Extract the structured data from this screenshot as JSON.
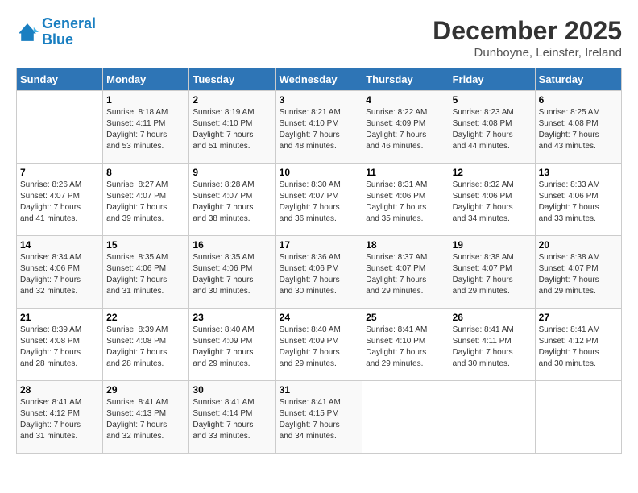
{
  "header": {
    "logo_line1": "General",
    "logo_line2": "Blue",
    "month": "December 2025",
    "location": "Dunboyne, Leinster, Ireland"
  },
  "days_of_week": [
    "Sunday",
    "Monday",
    "Tuesday",
    "Wednesday",
    "Thursday",
    "Friday",
    "Saturday"
  ],
  "weeks": [
    [
      {
        "day": "",
        "info": ""
      },
      {
        "day": "1",
        "info": "Sunrise: 8:18 AM\nSunset: 4:11 PM\nDaylight: 7 hours\nand 53 minutes."
      },
      {
        "day": "2",
        "info": "Sunrise: 8:19 AM\nSunset: 4:10 PM\nDaylight: 7 hours\nand 51 minutes."
      },
      {
        "day": "3",
        "info": "Sunrise: 8:21 AM\nSunset: 4:10 PM\nDaylight: 7 hours\nand 48 minutes."
      },
      {
        "day": "4",
        "info": "Sunrise: 8:22 AM\nSunset: 4:09 PM\nDaylight: 7 hours\nand 46 minutes."
      },
      {
        "day": "5",
        "info": "Sunrise: 8:23 AM\nSunset: 4:08 PM\nDaylight: 7 hours\nand 44 minutes."
      },
      {
        "day": "6",
        "info": "Sunrise: 8:25 AM\nSunset: 4:08 PM\nDaylight: 7 hours\nand 43 minutes."
      }
    ],
    [
      {
        "day": "7",
        "info": "Sunrise: 8:26 AM\nSunset: 4:07 PM\nDaylight: 7 hours\nand 41 minutes."
      },
      {
        "day": "8",
        "info": "Sunrise: 8:27 AM\nSunset: 4:07 PM\nDaylight: 7 hours\nand 39 minutes."
      },
      {
        "day": "9",
        "info": "Sunrise: 8:28 AM\nSunset: 4:07 PM\nDaylight: 7 hours\nand 38 minutes."
      },
      {
        "day": "10",
        "info": "Sunrise: 8:30 AM\nSunset: 4:07 PM\nDaylight: 7 hours\nand 36 minutes."
      },
      {
        "day": "11",
        "info": "Sunrise: 8:31 AM\nSunset: 4:06 PM\nDaylight: 7 hours\nand 35 minutes."
      },
      {
        "day": "12",
        "info": "Sunrise: 8:32 AM\nSunset: 4:06 PM\nDaylight: 7 hours\nand 34 minutes."
      },
      {
        "day": "13",
        "info": "Sunrise: 8:33 AM\nSunset: 4:06 PM\nDaylight: 7 hours\nand 33 minutes."
      }
    ],
    [
      {
        "day": "14",
        "info": "Sunrise: 8:34 AM\nSunset: 4:06 PM\nDaylight: 7 hours\nand 32 minutes."
      },
      {
        "day": "15",
        "info": "Sunrise: 8:35 AM\nSunset: 4:06 PM\nDaylight: 7 hours\nand 31 minutes."
      },
      {
        "day": "16",
        "info": "Sunrise: 8:35 AM\nSunset: 4:06 PM\nDaylight: 7 hours\nand 30 minutes."
      },
      {
        "day": "17",
        "info": "Sunrise: 8:36 AM\nSunset: 4:06 PM\nDaylight: 7 hours\nand 30 minutes."
      },
      {
        "day": "18",
        "info": "Sunrise: 8:37 AM\nSunset: 4:07 PM\nDaylight: 7 hours\nand 29 minutes."
      },
      {
        "day": "19",
        "info": "Sunrise: 8:38 AM\nSunset: 4:07 PM\nDaylight: 7 hours\nand 29 minutes."
      },
      {
        "day": "20",
        "info": "Sunrise: 8:38 AM\nSunset: 4:07 PM\nDaylight: 7 hours\nand 29 minutes."
      }
    ],
    [
      {
        "day": "21",
        "info": "Sunrise: 8:39 AM\nSunset: 4:08 PM\nDaylight: 7 hours\nand 28 minutes."
      },
      {
        "day": "22",
        "info": "Sunrise: 8:39 AM\nSunset: 4:08 PM\nDaylight: 7 hours\nand 28 minutes."
      },
      {
        "day": "23",
        "info": "Sunrise: 8:40 AM\nSunset: 4:09 PM\nDaylight: 7 hours\nand 29 minutes."
      },
      {
        "day": "24",
        "info": "Sunrise: 8:40 AM\nSunset: 4:09 PM\nDaylight: 7 hours\nand 29 minutes."
      },
      {
        "day": "25",
        "info": "Sunrise: 8:41 AM\nSunset: 4:10 PM\nDaylight: 7 hours\nand 29 minutes."
      },
      {
        "day": "26",
        "info": "Sunrise: 8:41 AM\nSunset: 4:11 PM\nDaylight: 7 hours\nand 30 minutes."
      },
      {
        "day": "27",
        "info": "Sunrise: 8:41 AM\nSunset: 4:12 PM\nDaylight: 7 hours\nand 30 minutes."
      }
    ],
    [
      {
        "day": "28",
        "info": "Sunrise: 8:41 AM\nSunset: 4:12 PM\nDaylight: 7 hours\nand 31 minutes."
      },
      {
        "day": "29",
        "info": "Sunrise: 8:41 AM\nSunset: 4:13 PM\nDaylight: 7 hours\nand 32 minutes."
      },
      {
        "day": "30",
        "info": "Sunrise: 8:41 AM\nSunset: 4:14 PM\nDaylight: 7 hours\nand 33 minutes."
      },
      {
        "day": "31",
        "info": "Sunrise: 8:41 AM\nSunset: 4:15 PM\nDaylight: 7 hours\nand 34 minutes."
      },
      {
        "day": "",
        "info": ""
      },
      {
        "day": "",
        "info": ""
      },
      {
        "day": "",
        "info": ""
      }
    ]
  ]
}
